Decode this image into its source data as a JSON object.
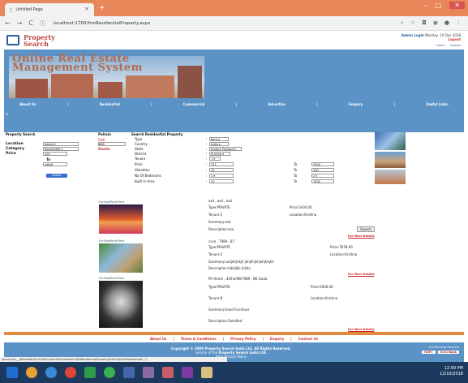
{
  "browser": {
    "tab_title": "Untitled Page",
    "url": "localhost:1700/frmResidentialProperty.aspx",
    "win_min": "–",
    "win_max": "□",
    "win_close": "✕"
  },
  "header": {
    "logo_line1": "Property",
    "logo_line2": "Search",
    "login_name": "Admin Login",
    "date": "Monday, 10 Dec 2018",
    "logout": "Logout",
    "links": [
      "Home",
      "Contact"
    ]
  },
  "banner": {
    "title_line1": "Online Real Estate",
    "title_line2": "Management System"
  },
  "menu": [
    "About Us",
    "|",
    "Residential",
    "|",
    "Commercial",
    "|",
    "Advertise",
    "|",
    "Enquiry",
    "|",
    "Useful Links"
  ],
  "left_search": {
    "title": "Property Search",
    "location_label": "Location",
    "location_value": "Select",
    "category_label": "Category",
    "category_value": "Residential",
    "price_label": "Price",
    "price_value": "100",
    "to_label": "To",
    "to_value": "sdfsdf",
    "submit": "SUBMIT"
  },
  "mid": {
    "title": "Polrain",
    "value1": "RINI",
    "value2": "888",
    "value3": "Studio"
  },
  "residential_search": {
    "title": "Search Residential Property",
    "fields": [
      {
        "label": "Type",
        "value": "Rent"
      },
      {
        "label": "Country",
        "value": "India"
      },
      {
        "label": "State",
        "value": "Andhra Pradesh"
      },
      {
        "label": "District",
        "value": "Krishna"
      },
      {
        "label": "Tenure",
        "value": "1"
      },
      {
        "label": "Price",
        "value": "121",
        "to": "3000"
      },
      {
        "label": "Valuation",
        "value": "15",
        "to": "100"
      },
      {
        "label": "No Of Bedrooms",
        "value": "1",
        "to": "2"
      },
      {
        "label": "Built In Area",
        "value": "11",
        "to": "1000"
      }
    ],
    "to_label": "To",
    "search_button": "Search"
  },
  "listings": [
    {
      "caption": "ForSale/Rent:Rent",
      "heading": "asd , asd , asd",
      "type": "Type:PRIVATE",
      "price": "Price:3434.00",
      "tenure": "Tenure:2",
      "location": "Location:Krishna",
      "summary": "Summary:asd",
      "description": "Description:asa",
      "more": "For More Details"
    },
    {
      "caption": "ForSale/Rent:Rent",
      "heading": "cvce , 7989 , 87",
      "type": "Type:PRIVATE",
      "price": "Price:7878.00",
      "tenure": "Tenure:2",
      "location": "Location:Krishna",
      "summary": "Summary:uuhjkhjhkjh jkhjkhjkhjkhjkhjkh",
      "description": "Description:hjkhjhjk jhjkhj",
      "more": "For More Details"
    },
    {
      "caption": "ForSale/Rent:Rent",
      "heading": "Ph Home , 45/hd/98/7989 , BK Guda",
      "type": "Type:PRIVATE",
      "price": "Price:5000.00",
      "tenure": "Tenure:8",
      "location": "Location:Krishna",
      "summary": "Summary:Good Furniture",
      "description": "Description:Satisfied",
      "more": "For More Details"
    }
  ],
  "footer_links": [
    "About Us",
    "|",
    "Terms & Conditions",
    "|",
    "Privacy Policy",
    "|",
    "Enquiry",
    "|",
    "Contact Us"
  ],
  "footer": {
    "copyright": "Copyright © 2008 Property Search India Ltd. All Rights Reserved.",
    "line2a": "service of the ",
    "line2b": "Property Search India Ltd.",
    "line3": "All & Privacy Policy",
    "partners_label": "Our Banking Partners",
    "partner1": "HDFC",
    "partner2": "ICICI Bank"
  },
  "statusbar": "javascript:__doPostBack('ctl00$ContentPlaceHolder1$dlResidentialProperty$ctl01$hdfnMoreDetails','')",
  "clock": {
    "time": "12:59 PM",
    "date": "12/10/2018"
  }
}
